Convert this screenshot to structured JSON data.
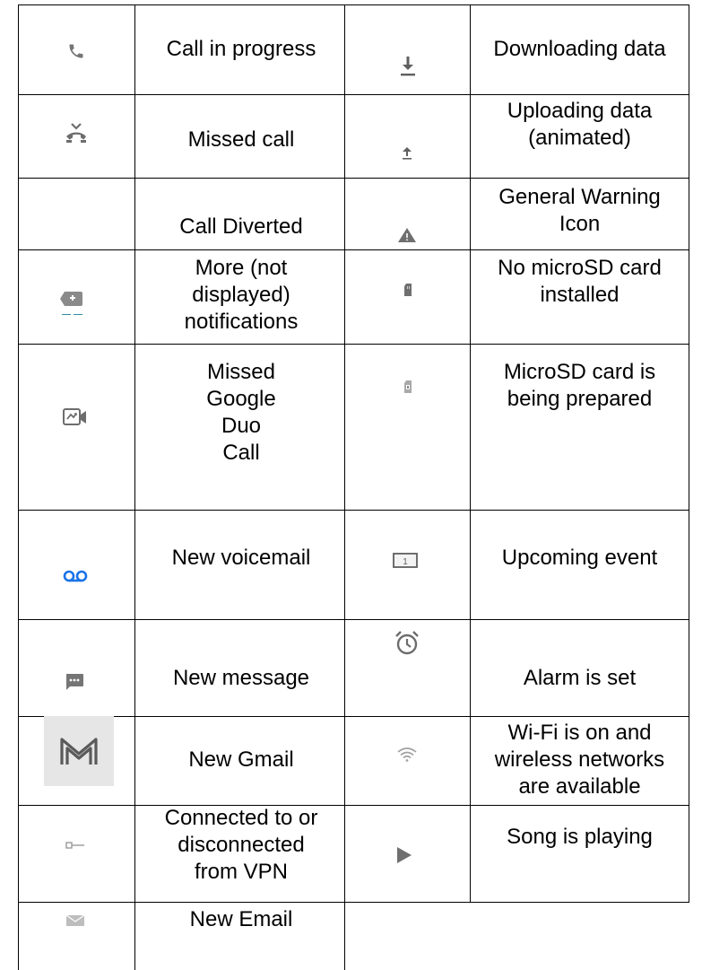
{
  "colors": {
    "icon_gray": "#757575",
    "icon_light": "#b7b7b7",
    "voicemail_blue": "#1a73e8",
    "gmail_bg": "#e6e6e6",
    "grid": "#000000",
    "text": "#000000"
  },
  "left_rows": [
    {
      "icon": "phone-icon",
      "label": "Call in progress"
    },
    {
      "icon": "missed-call-icon",
      "label": "Missed call"
    },
    {
      "icon": "",
      "label": "Call Diverted"
    },
    {
      "icon": "more-notifications-icon",
      "label": "More   (not\ndisplayed)\nnotifications"
    },
    {
      "icon": "duo-video-icon",
      "label": "Missed\nGoogle\nDuo\nCall"
    },
    {
      "icon": "voicemail-icon",
      "label": "New voicemail"
    },
    {
      "icon": "message-icon",
      "label": "New message"
    },
    {
      "icon": "gmail-icon",
      "label": "New Gmail"
    },
    {
      "icon": "vpn-key-icon",
      "label": "Connected to or\ndisconnected\nfrom VPN"
    },
    {
      "icon": "email-icon",
      "label": "New Email"
    }
  ],
  "right_rows": [
    {
      "icon": "download-icon",
      "label": "Downloading data"
    },
    {
      "icon": "upload-icon",
      "label": "Uploading data\n(animated)"
    },
    {
      "icon": "warning-icon",
      "label": "General Warning\nIcon"
    },
    {
      "icon": "no-sd-card-icon",
      "label": "No microSD card\ninstalled"
    },
    {
      "icon": "sd-card-preparing-icon",
      "label": "MicroSD card is\nbeing prepared"
    },
    {
      "icon": "calendar-event-icon",
      "label": "Upcoming event"
    },
    {
      "icon": "alarm-icon",
      "label": "Alarm is set"
    },
    {
      "icon": "wifi-icon",
      "label": "Wi-Fi is on and\nwireless networks\nare available"
    },
    {
      "icon": "play-icon",
      "label": "Song is playing"
    }
  ]
}
